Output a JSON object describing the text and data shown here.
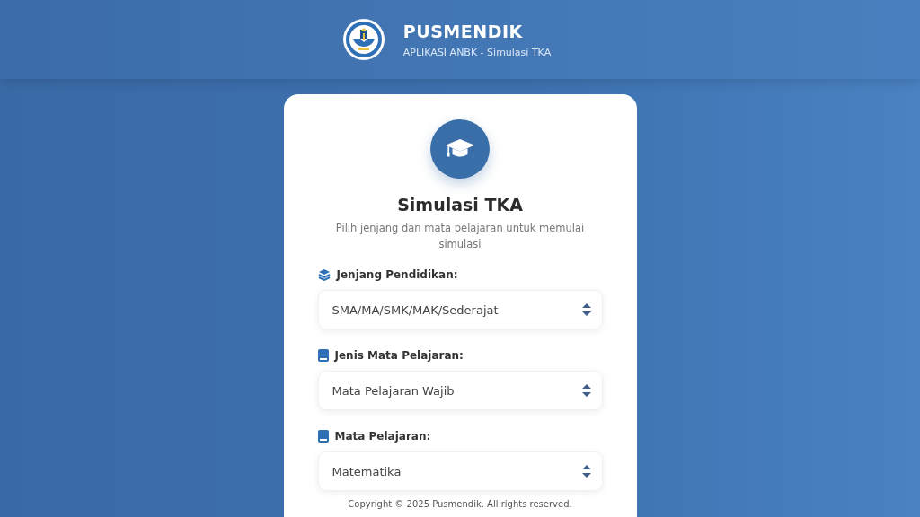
{
  "header": {
    "title": "PUSMENDIK",
    "subtitle": "APLIKASI ANBK - Simulasi TKA"
  },
  "card": {
    "title": "Simulasi TKA",
    "description": "Pilih jenjang dan mata pelajaran untuk memulai simulasi",
    "fields": [
      {
        "label": "Jenjang Pendidikan:",
        "value": "SMA/MA/SMK/MAK/Sederajat"
      },
      {
        "label": "Jenis Mata Pelajaran:",
        "value": "Mata Pelajaran Wajib"
      },
      {
        "label": "Mata Pelajaran:",
        "value": "Matematika"
      }
    ]
  },
  "footer": {
    "copyright": "Copyright © 2025 Pusmendik. All rights reserved."
  }
}
